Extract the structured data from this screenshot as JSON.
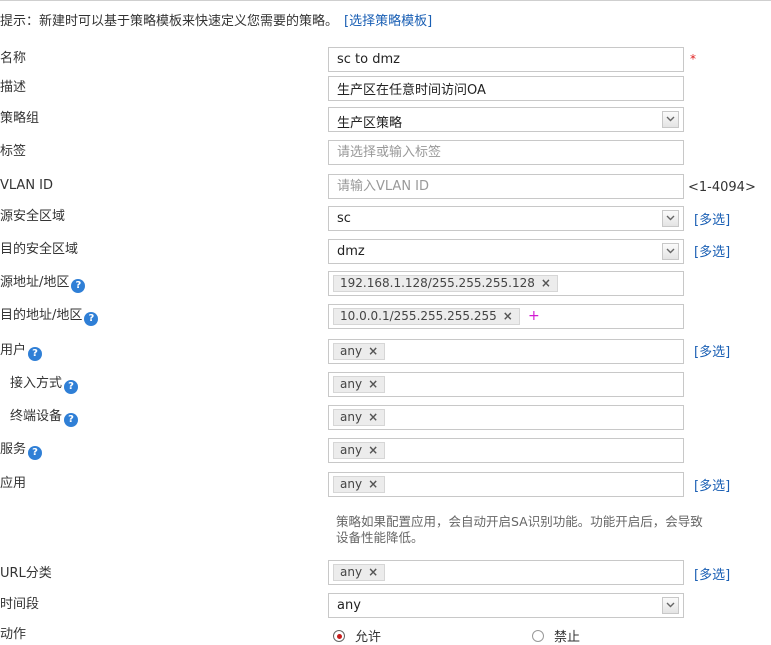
{
  "hint": {
    "text": "提示：新建时可以基于策略模板来快速定义您需要的策略。",
    "link": "[选择策略模板]"
  },
  "labels": {
    "name": "名称",
    "description": "描述",
    "policy_group": "策略组",
    "tag": "标签",
    "vlan": "VLAN ID",
    "src_zone": "源安全区域",
    "dst_zone": "目的安全区域",
    "src_addr": "源地址/地区",
    "dst_addr": "目的地址/地区",
    "user": "用户",
    "access_mode": "接入方式",
    "terminal": "终端设备",
    "service": "服务",
    "application": "应用",
    "url_category": "URL分类",
    "time_range": "时间段",
    "action": "动作"
  },
  "fields": {
    "name_value": "sc to dmz",
    "description_value": "生产区在任意时间访问OA",
    "policy_group_value": "生产区策略",
    "tag_placeholder": "请选择或输入标签",
    "vlan_placeholder": "请输入VLAN ID",
    "vlan_range": "<1-4094>",
    "src_zone_value": "sc",
    "dst_zone_value": "dmz",
    "src_addr_tag": "192.168.1.128/255.255.255.128",
    "dst_addr_tag": "10.0.0.1/255.255.255.255",
    "user_tag": "any",
    "access_mode_tag": "any",
    "terminal_tag": "any",
    "service_tag": "any",
    "application_tag": "any",
    "url_category_tag": "any",
    "time_range_value": "any"
  },
  "app_note": "策略如果配置应用，会自动开启SA识别功能。功能开启后，会导致设备性能降低。",
  "multi_select_label": "[多选]",
  "required_mark": "*",
  "tag_remove": "×",
  "help_glyph": "?",
  "action": {
    "permit_label": "允许",
    "deny_label": "禁止",
    "selected": "permit"
  },
  "colors": {
    "link": "#1a5fb4",
    "help_icon": "#2f7fd6",
    "radio_selected": "#c51d1d",
    "required": "#e02020"
  }
}
